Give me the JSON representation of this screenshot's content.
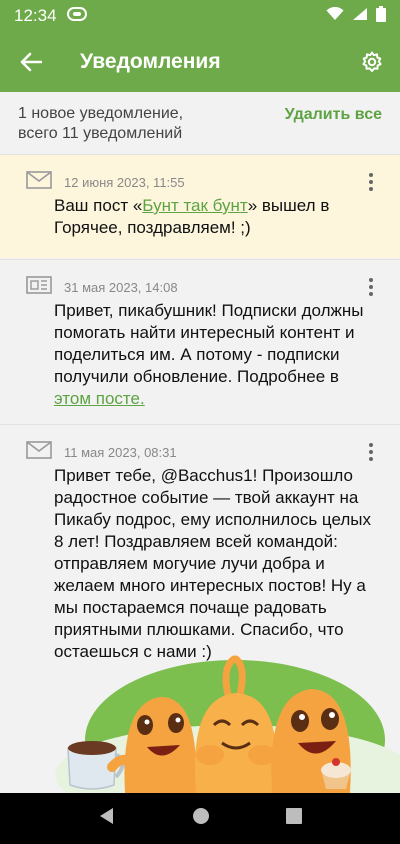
{
  "status_bar": {
    "time": "12:34"
  },
  "app_bar": {
    "title": "Уведомления"
  },
  "summary": {
    "line1": "1 новое уведомление,",
    "line2": "всего 11 уведомлений",
    "delete_all": "Удалить все"
  },
  "notifications": [
    {
      "date": "12 июня 2023, 11:55",
      "text_before": "Ваш пост «",
      "link": "Бунт так бунт",
      "text_after": "» вышел в Горячее, поздравляем! ;)",
      "icon": "envelope-icon",
      "unread": true
    },
    {
      "date": "31 мая 2023, 14:08",
      "text": "Привет, пикабушник! Подписки должны помогать найти интересный контент и поделиться им. А потому - подписки получили обновление. Подробнее в ",
      "link": "этом посте.",
      "icon": "newspaper-icon",
      "unread": false
    },
    {
      "date": "11 мая 2023, 08:31",
      "text": "Привет тебе, @Bacchus1! Произошло радостное событие — твой аккаунт на Пикабу подрос, ему исполнилось целых 8 лет! Поздравляем всей командой: отправляем могучие лучи добра и желаем много интересных постов! Ну а мы постараемся почаще радовать приятными плюшками. Спасибо, что остаешься с нами :)",
      "icon": "envelope-icon",
      "unread": false
    }
  ],
  "colors": {
    "accent": "#6ea94a",
    "link": "#5da343",
    "unread_bg": "#fdf6dd"
  }
}
